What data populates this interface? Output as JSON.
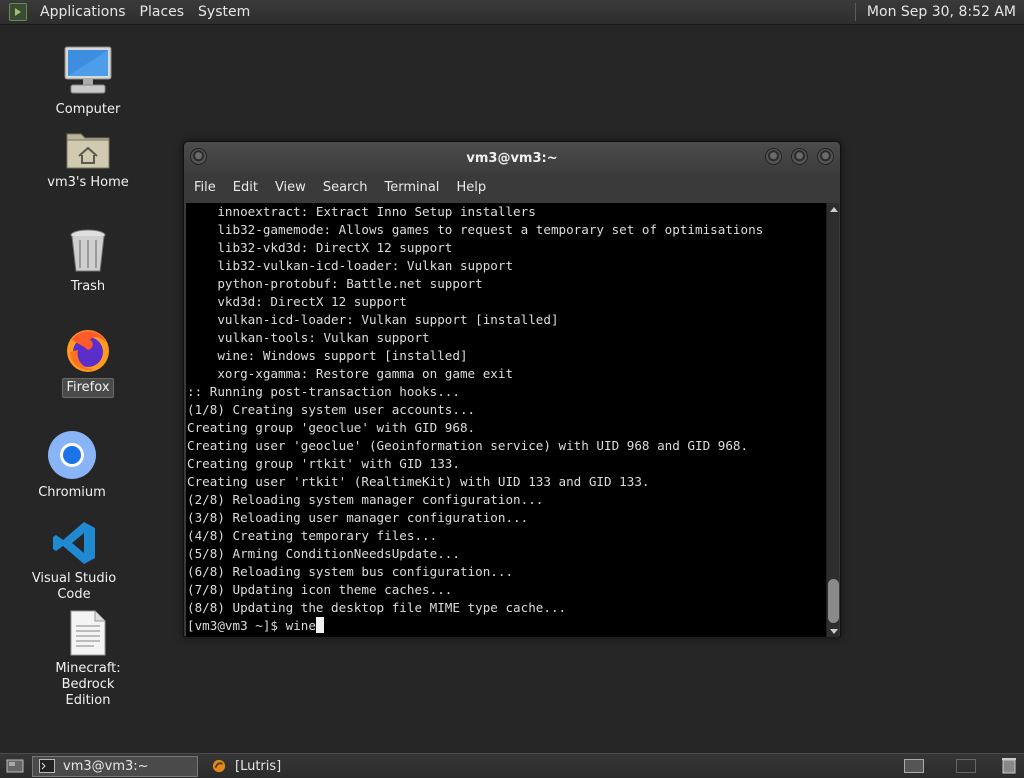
{
  "top_panel": {
    "menus": [
      "Applications",
      "Places",
      "System"
    ],
    "clock": "Mon Sep 30,  8:52 AM"
  },
  "desktop_icons": [
    {
      "label": "Computer",
      "icon": "computer-icon"
    },
    {
      "label": "vm3's Home",
      "icon": "home-folder-icon"
    },
    {
      "label": "Trash",
      "icon": "trash-icon"
    },
    {
      "label": "Firefox",
      "icon": "firefox-icon"
    },
    {
      "label": "Chromium",
      "icon": "chromium-icon"
    },
    {
      "label": "Visual Studio Code",
      "icon": "vscode-icon"
    },
    {
      "label": "Minecraft: Bedrock\nEdition",
      "icon": "document-icon"
    }
  ],
  "terminal": {
    "title": "vm3@vm3:~",
    "menus": [
      "File",
      "Edit",
      "View",
      "Search",
      "Terminal",
      "Help"
    ],
    "lines": [
      "    innoextract: Extract Inno Setup installers",
      "    lib32-gamemode: Allows games to request a temporary set of optimisations",
      "    lib32-vkd3d: DirectX 12 support",
      "    lib32-vulkan-icd-loader: Vulkan support",
      "    python-protobuf: Battle.net support",
      "    vkd3d: DirectX 12 support",
      "    vulkan-icd-loader: Vulkan support [installed]",
      "    vulkan-tools: Vulkan support",
      "    wine: Windows support [installed]",
      "    xorg-xgamma: Restore gamma on game exit",
      ":: Running post-transaction hooks...",
      "(1/8) Creating system user accounts...",
      "Creating group 'geoclue' with GID 968.",
      "Creating user 'geoclue' (Geoinformation service) with UID 968 and GID 968.",
      "Creating group 'rtkit' with GID 133.",
      "Creating user 'rtkit' (RealtimeKit) with UID 133 and GID 133.",
      "(2/8) Reloading system manager configuration...",
      "(3/8) Reloading user manager configuration...",
      "(4/8) Creating temporary files...",
      "(5/8) Arming ConditionNeedsUpdate...",
      "(6/8) Reloading system bus configuration...",
      "(7/8) Updating icon theme caches...",
      "(8/8) Updating the desktop file MIME type cache..."
    ],
    "prompt": "[vm3@vm3 ~]$ wine"
  },
  "taskbar": {
    "tasks": [
      "vm3@vm3:~",
      "[Lutris]"
    ]
  },
  "colors": {
    "desktop_bg": "#262626",
    "terminal_bg": "#000000",
    "terminal_fg": "#dcdcdc"
  }
}
